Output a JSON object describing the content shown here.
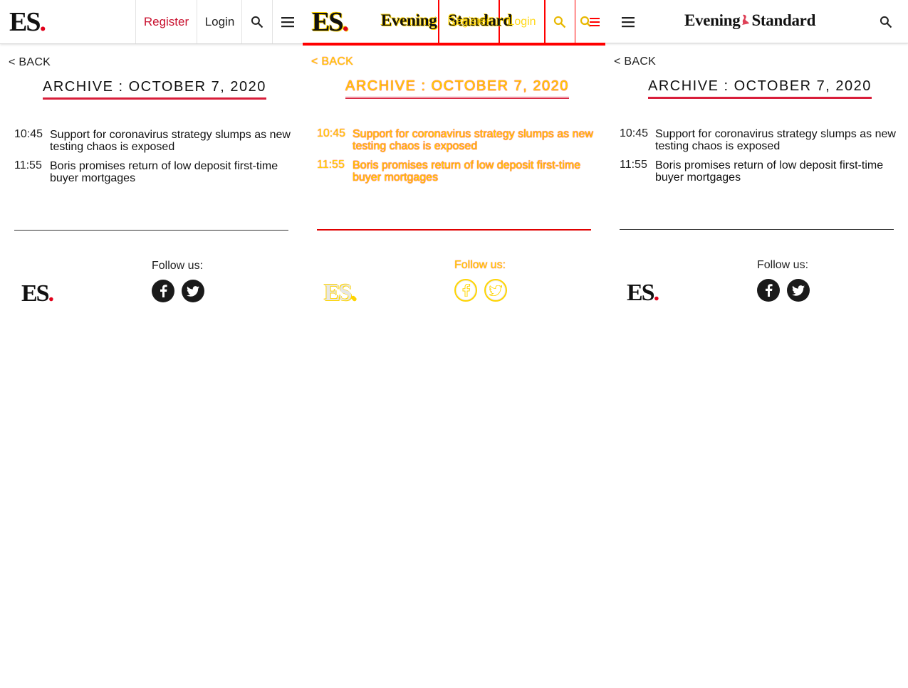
{
  "brand": {
    "short_logo": "ES",
    "logo_dot": ".",
    "full_logo_left": "Evening",
    "full_logo_right": "Standard",
    "accent": "#c8102e",
    "underline": "#d81e3a"
  },
  "header": {
    "register_label": "Register",
    "login_label": "Login",
    "search_icon": "search-icon",
    "menu_icon": "menu-icon"
  },
  "page": {
    "back_label": "< BACK",
    "title": "ARCHIVE : OCTOBER 7, 2020"
  },
  "articles": [
    {
      "time": "10:45",
      "headline": "Support for coronavirus strategy slumps as new testing chaos is exposed"
    },
    {
      "time": "11:55",
      "headline": "Boris promises return of low deposit first-time buyer mortgages"
    }
  ],
  "footer": {
    "follow_label": "Follow us:",
    "social": [
      "facebook-icon",
      "twitter-icon"
    ]
  }
}
